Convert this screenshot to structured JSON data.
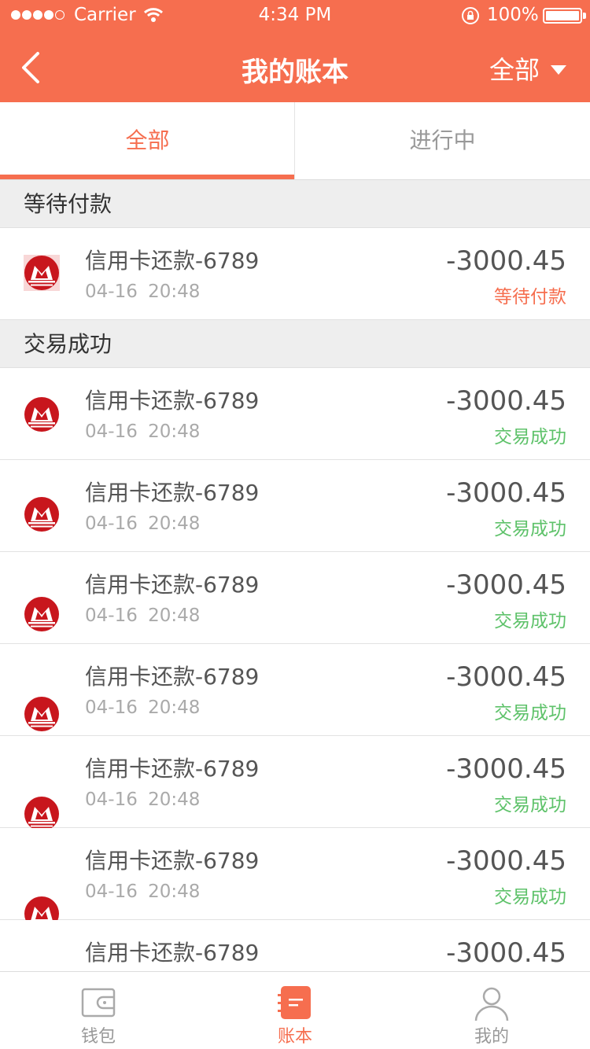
{
  "status_bar": {
    "carrier": "Carrier",
    "time": "4:34 PM",
    "battery": "100%"
  },
  "nav": {
    "title": "我的账本",
    "filter_label": "全部"
  },
  "tabs": [
    {
      "label": "全部",
      "active": true
    },
    {
      "label": "进行中",
      "active": false
    }
  ],
  "sections": [
    {
      "title": "等待付款",
      "rows": [
        {
          "title": "信用卡还款-6789",
          "time": "04-16 20:48",
          "amount": "-3000.45",
          "status": "等待付款",
          "state": "pending"
        }
      ]
    },
    {
      "title": "交易成功",
      "rows": [
        {
          "title": "信用卡还款-6789",
          "time": "04-16 20:48",
          "amount": "-3000.45",
          "status": "交易成功",
          "state": "ok"
        },
        {
          "title": "信用卡还款-6789",
          "time": "04-16 20:48",
          "amount": "-3000.45",
          "status": "交易成功",
          "state": "ok"
        },
        {
          "title": "信用卡还款-6789",
          "time": "04-16 20:48",
          "amount": "-3000.45",
          "status": "交易成功",
          "state": "ok"
        },
        {
          "title": "信用卡还款-6789",
          "time": "04-16 20:48",
          "amount": "-3000.45",
          "status": "交易成功",
          "state": "ok"
        },
        {
          "title": "信用卡还款-6789",
          "time": "04-16 20:48",
          "amount": "-3000.45",
          "status": "交易成功",
          "state": "ok"
        },
        {
          "title": "信用卡还款-6789",
          "time": "04-16 20:48",
          "amount": "-3000.45",
          "status": "交易成功",
          "state": "ok"
        },
        {
          "title": "信用卡还款-6789",
          "time": "",
          "amount": "-3000.45",
          "status": "",
          "state": "ok"
        }
      ]
    }
  ],
  "tabbar": [
    {
      "label": "钱包",
      "icon": "wallet-icon",
      "active": false
    },
    {
      "label": "账本",
      "icon": "ledger-icon",
      "active": true
    },
    {
      "label": "我的",
      "icon": "profile-icon",
      "active": false
    }
  ],
  "colors": {
    "accent": "#f66e4f",
    "success": "#5ec26a",
    "bank_red": "#c8161d"
  }
}
